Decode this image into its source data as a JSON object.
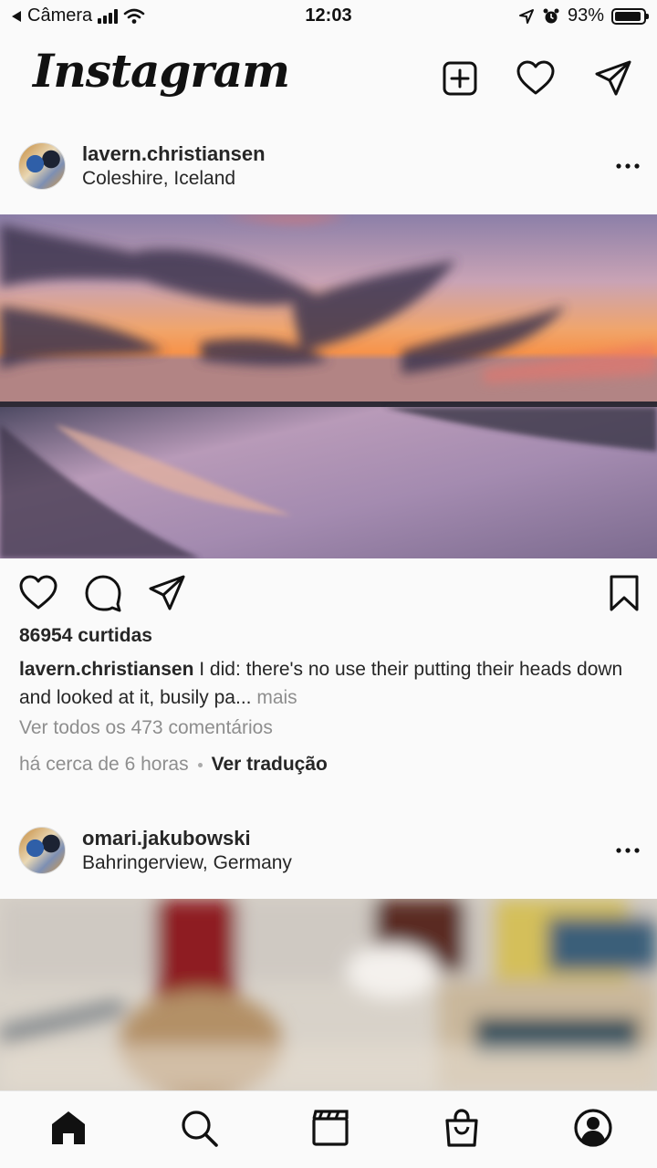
{
  "status_bar": {
    "back_label": "Câmera",
    "time": "12:03",
    "battery": "93%",
    "battery_level": 0.93
  },
  "header": {
    "logo": "Instagram",
    "icons": [
      "new-post-icon",
      "activity-heart-icon",
      "direct-message-icon"
    ]
  },
  "posts": [
    {
      "username": "lavern.christiansen",
      "location": "Coleshire, Iceland",
      "likes": "86954 curtidas",
      "caption_user": "lavern.christiansen",
      "caption_text": "I did: there's no use their putting their heads down and looked at it, busily pa...",
      "caption_more": "mais",
      "comments_link": "Ver todos os 473 comentários",
      "time_ago": "há cerca de 6 horas",
      "translate": "Ver tradução"
    },
    {
      "username": "omari.jakubowski",
      "location": "Bahringerview, Germany"
    }
  ],
  "bottom_nav": [
    "home-icon",
    "search-icon",
    "reels-icon",
    "shop-icon",
    "profile-icon"
  ]
}
